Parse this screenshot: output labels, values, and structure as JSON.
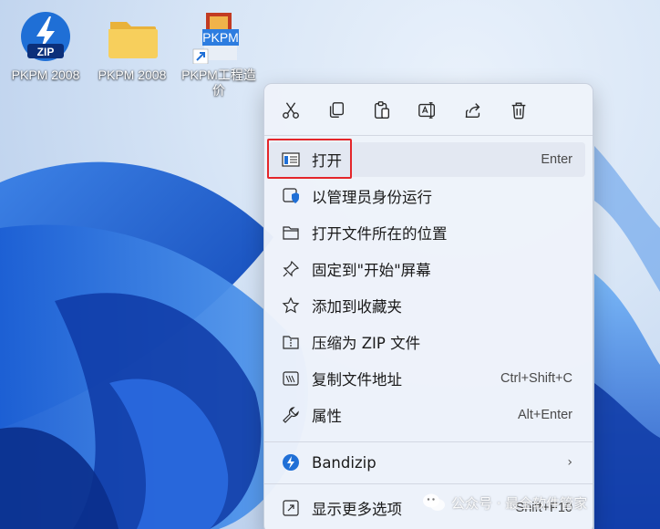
{
  "desktop": {
    "icons": [
      {
        "label": "PKPM 2008",
        "type": "zip-archive-icon"
      },
      {
        "label": "PKPM 2008",
        "type": "folder-icon"
      },
      {
        "label": "PKPM工程造价",
        "type": "pkpm-app-shortcut-icon",
        "logo_text": "PKPM"
      }
    ],
    "zip_badge": "ZIP"
  },
  "menu": {
    "toolbar": [
      {
        "name": "cut",
        "icon": "scissors-icon"
      },
      {
        "name": "copy",
        "icon": "copy-icon"
      },
      {
        "name": "paste",
        "icon": "paste-icon"
      },
      {
        "name": "rename",
        "icon": "rename-icon"
      },
      {
        "name": "share",
        "icon": "share-icon"
      },
      {
        "name": "delete",
        "icon": "trash-icon"
      }
    ],
    "items": [
      {
        "label": "打开",
        "shortcut": "Enter",
        "icon": "open-window-icon"
      },
      {
        "label": "以管理员身份运行",
        "shortcut": "",
        "icon": "shield-icon"
      },
      {
        "label": "打开文件所在的位置",
        "shortcut": "",
        "icon": "folder-icon"
      },
      {
        "label": "固定到\"开始\"屏幕",
        "shortcut": "",
        "icon": "pin-icon"
      },
      {
        "label": "添加到收藏夹",
        "shortcut": "",
        "icon": "star-icon"
      },
      {
        "label": "压缩为 ZIP 文件",
        "shortcut": "",
        "icon": "zip-folder-icon"
      },
      {
        "label": "复制文件地址",
        "shortcut": "Ctrl+Shift+C",
        "icon": "path-copy-icon"
      },
      {
        "label": "属性",
        "shortcut": "Alt+Enter",
        "icon": "wrench-icon"
      },
      {
        "label": "Bandizip",
        "shortcut": "",
        "icon": "bandizip-icon",
        "submenu": "›"
      },
      {
        "label": "显示更多选项",
        "shortcut": "Shift+F10",
        "icon": "expand-icon"
      }
    ]
  },
  "watermark": {
    "text": "公众号 · 最全软件管家"
  },
  "colors": {
    "accent": "#1f6fd6",
    "highlight_box": "#e4262a"
  }
}
